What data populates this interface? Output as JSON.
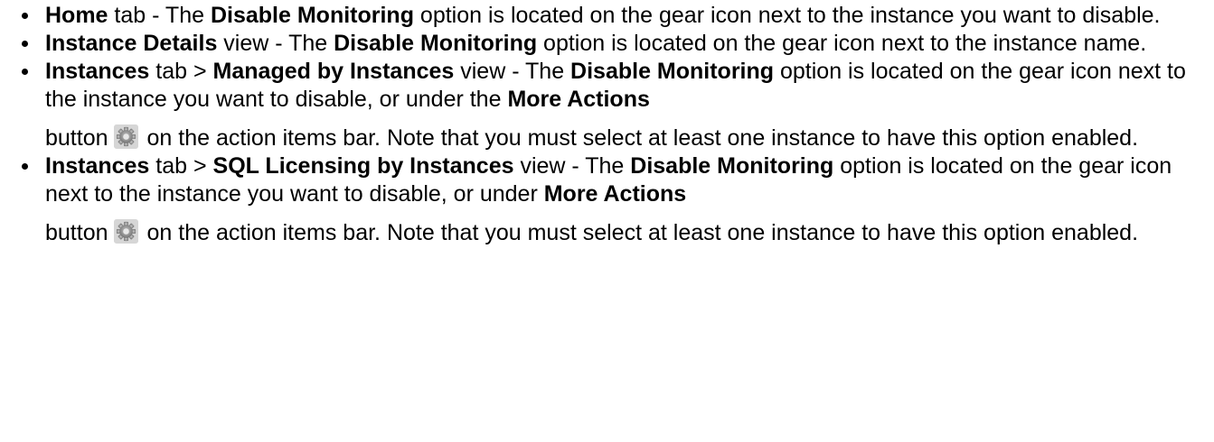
{
  "items": [
    {
      "tab": "Home",
      "tab_suffix": " tab - The ",
      "option": "Disable Monitoring",
      "text": " option is located on the gear icon next to the instance you want to disable."
    },
    {
      "tab": "Instance Details",
      "tab_suffix": " view - The ",
      "option": "Disable Monitoring",
      "text": " option is located on the gear icon next to the instance name."
    },
    {
      "tab": "Instances",
      "tab_suffix": " tab > ",
      "view": "Managed by Instances",
      "view_suffix": " view - The ",
      "option": "Disable Monitoring",
      "text": " option is located on the gear icon next to the instance you want to disable, or under the ",
      "button_name": "More Actions",
      "button_word": "button",
      "icon": "gear-icon",
      "after": "on the action items bar. Note that you must select at least one instance to have this option enabled."
    },
    {
      "tab": "Instances",
      "tab_suffix": " tab > ",
      "view": "SQL Licensing by Instances",
      "view_suffix": "  view - The ",
      "option": "Disable Monitoring",
      "text": " option is located on the gear icon next to the instance you want to disable, or under ",
      "button_name": "More Actions",
      "button_word": "button",
      "icon": "gear-icon",
      "after": "on the action items bar. Note that you must select at least one instance to have this option enabled."
    }
  ]
}
